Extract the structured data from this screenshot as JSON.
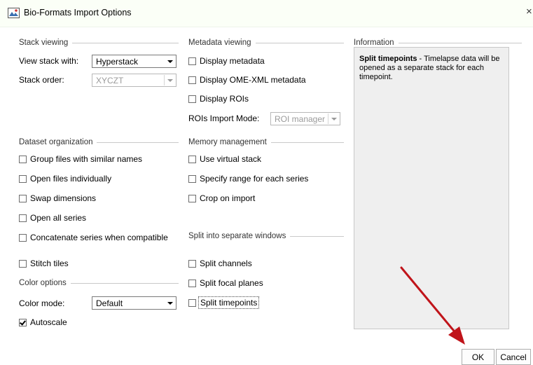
{
  "window": {
    "title": "Bio-Formats Import Options",
    "close_glyph": "×",
    "icon": "bio-formats-app-icon"
  },
  "stack_viewing": {
    "header": "Stack viewing",
    "view_stack_label": "View stack with:",
    "view_stack_value": "Hyperstack",
    "stack_order_label": "Stack order:",
    "stack_order_value": "XYCZT"
  },
  "metadata_viewing": {
    "header": "Metadata viewing",
    "display_metadata": "Display metadata",
    "display_ome_xml": "Display OME-XML metadata",
    "display_rois": "Display ROIs",
    "rois_mode_label": "ROIs Import Mode:",
    "rois_mode_value": "ROI manager"
  },
  "information": {
    "header": "Information",
    "bold": "Split timepoints",
    "text": " - Timelapse data will be opened as a separate stack for each timepoint."
  },
  "dataset_organization": {
    "header": "Dataset organization",
    "group_files": "Group files with similar names",
    "open_individually": "Open files individually",
    "swap_dimensions": "Swap dimensions",
    "open_all_series": "Open all series",
    "concatenate": "Concatenate series when compatible",
    "stitch_tiles": "Stitch tiles"
  },
  "memory_management": {
    "header": "Memory management",
    "virtual_stack": "Use virtual stack",
    "specify_range": "Specify range for each series",
    "crop_on_import": "Crop on import"
  },
  "split_windows": {
    "header": "Split into separate windows",
    "split_channels": "Split channels",
    "split_focal": "Split focal planes",
    "split_timepoints": "Split timepoints"
  },
  "color_options": {
    "header": "Color options",
    "mode_label": "Color mode:",
    "mode_value": "Default",
    "autoscale": "Autoscale",
    "autoscale_checked": true
  },
  "buttons": {
    "ok": "OK",
    "cancel": "Cancel"
  },
  "annotation": {
    "arrow_color": "#c0141a"
  }
}
